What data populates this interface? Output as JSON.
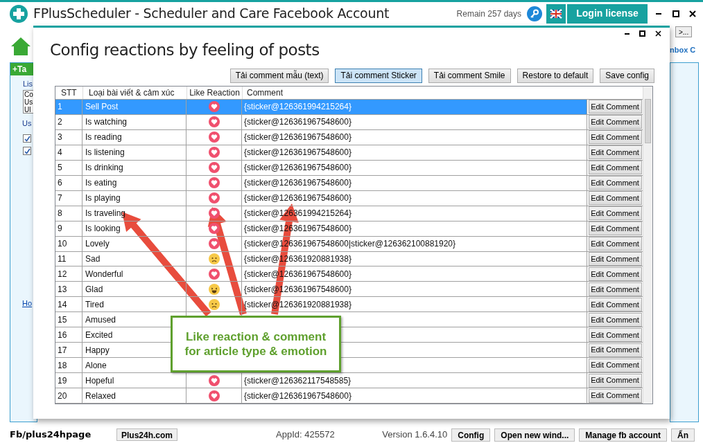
{
  "app": {
    "title": "FPlusScheduler - Scheduler and Care Facebook Account",
    "remain": "Remain 257 days",
    "login_button": "Login license"
  },
  "background": {
    "tab": "+Ta",
    "list_label": "Lis",
    "list_items": [
      "Co",
      "Us",
      "Ul"
    ],
    "use_label": "Us",
    "checkboxes": [
      {
        "checked": true
      },
      {
        "checked": true
      }
    ],
    "link": "Ho",
    "right_button": ">...",
    "right_label": "nbox C"
  },
  "dialog": {
    "title": "Config reactions by feeling of posts",
    "buttons": [
      {
        "label": "Tải comment mẫu (text)",
        "selected": false
      },
      {
        "label": "Tải comment Sticker",
        "selected": true
      },
      {
        "label": "Tải comment Smile",
        "selected": false
      },
      {
        "label": "Restore to default",
        "selected": false
      },
      {
        "label": "Save config",
        "selected": false
      }
    ],
    "table": {
      "columns": [
        "STT",
        "Loại bài viết & cảm xúc",
        "Like Reaction",
        "Comment"
      ],
      "rows": [
        {
          "stt": "1",
          "type": "Sell Post",
          "reaction": {
            "kind": "love"
          },
          "comment": "{sticker@126361994215264}",
          "action": "Edit Comment",
          "selected": true
        },
        {
          "stt": "2",
          "type": "Is watching",
          "reaction": {
            "kind": "love"
          },
          "comment": "{sticker@126361967548600}",
          "action": "Edit Comment",
          "selected": false
        },
        {
          "stt": "3",
          "type": "Is reading",
          "reaction": {
            "kind": "love"
          },
          "comment": "{sticker@126361967548600}",
          "action": "Edit Comment",
          "selected": false
        },
        {
          "stt": "4",
          "type": "Is listening",
          "reaction": {
            "kind": "love"
          },
          "comment": "{sticker@126361967548600}",
          "action": "Edit Comment",
          "selected": false
        },
        {
          "stt": "5",
          "type": "Is drinking",
          "reaction": {
            "kind": "love"
          },
          "comment": "{sticker@126361967548600}",
          "action": "Edit Comment",
          "selected": false
        },
        {
          "stt": "6",
          "type": "Is eating",
          "reaction": {
            "kind": "love"
          },
          "comment": "{sticker@126361967548600}",
          "action": "Edit Comment",
          "selected": false
        },
        {
          "stt": "7",
          "type": "Is playing",
          "reaction": {
            "kind": "love"
          },
          "comment": "{sticker@126361967548600}",
          "action": "Edit Comment",
          "selected": false
        },
        {
          "stt": "8",
          "type": "Is traveling",
          "reaction": {
            "kind": "love"
          },
          "comment": "{sticker@126361994215264}",
          "action": "Edit Comment",
          "selected": false
        },
        {
          "stt": "9",
          "type": "Is looking",
          "reaction": {
            "kind": "love"
          },
          "comment": "{sticker@126361967548600}",
          "action": "Edit Comment",
          "selected": false
        },
        {
          "stt": "10",
          "type": "Lovely",
          "reaction": {
            "kind": "love"
          },
          "comment": "{sticker@126361967548600|sticker@126362100881920}",
          "action": "Edit Comment",
          "selected": false
        },
        {
          "stt": "11",
          "type": "Sad",
          "reaction": {
            "kind": "sad"
          },
          "comment": "{sticker@126361920881938}",
          "action": "Edit Comment",
          "selected": false
        },
        {
          "stt": "12",
          "type": "Wonderful",
          "reaction": {
            "kind": "love"
          },
          "comment": "{sticker@126361967548600}",
          "action": "Edit Comment",
          "selected": false
        },
        {
          "stt": "13",
          "type": "Glad",
          "reaction": {
            "kind": "haha"
          },
          "comment": "{sticker@126361967548600}",
          "action": "Edit Comment",
          "selected": false
        },
        {
          "stt": "14",
          "type": "Tired",
          "reaction": {
            "kind": "sad"
          },
          "comment": "{sticker@126361920881938}",
          "action": "Edit Comment",
          "selected": false
        },
        {
          "stt": "15",
          "type": "Amused",
          "action": "Edit Comment",
          "selected": false
        },
        {
          "stt": "16",
          "type": "Excited",
          "action": "Edit Comment",
          "selected": false
        },
        {
          "stt": "17",
          "type": "Happy",
          "action": "Edit Comment",
          "selected": false
        },
        {
          "stt": "18",
          "type": "Alone",
          "action": "Edit Comment",
          "selected": false
        },
        {
          "stt": "19",
          "type": "Hopeful",
          "reaction": {
            "kind": "love"
          },
          "comment": "{sticker@126362117548585}",
          "action": "Edit Comment",
          "selected": false
        },
        {
          "stt": "20",
          "type": "Relaxed",
          "reaction": {
            "kind": "love"
          },
          "comment": "{sticker@126361967548600}",
          "action": "Edit Comment",
          "selected": false
        }
      ]
    },
    "callout": "Like reaction & comment for article type & emotion"
  },
  "status_bar": {
    "page": "Fb/plus24hpage",
    "site_button": "Plus24h.com",
    "app_id": "AppId: 425572",
    "version": "Version 1.6.4.10",
    "buttons": [
      "Config",
      "Open new wind...",
      "Manage fb account",
      "Ẩn"
    ]
  }
}
